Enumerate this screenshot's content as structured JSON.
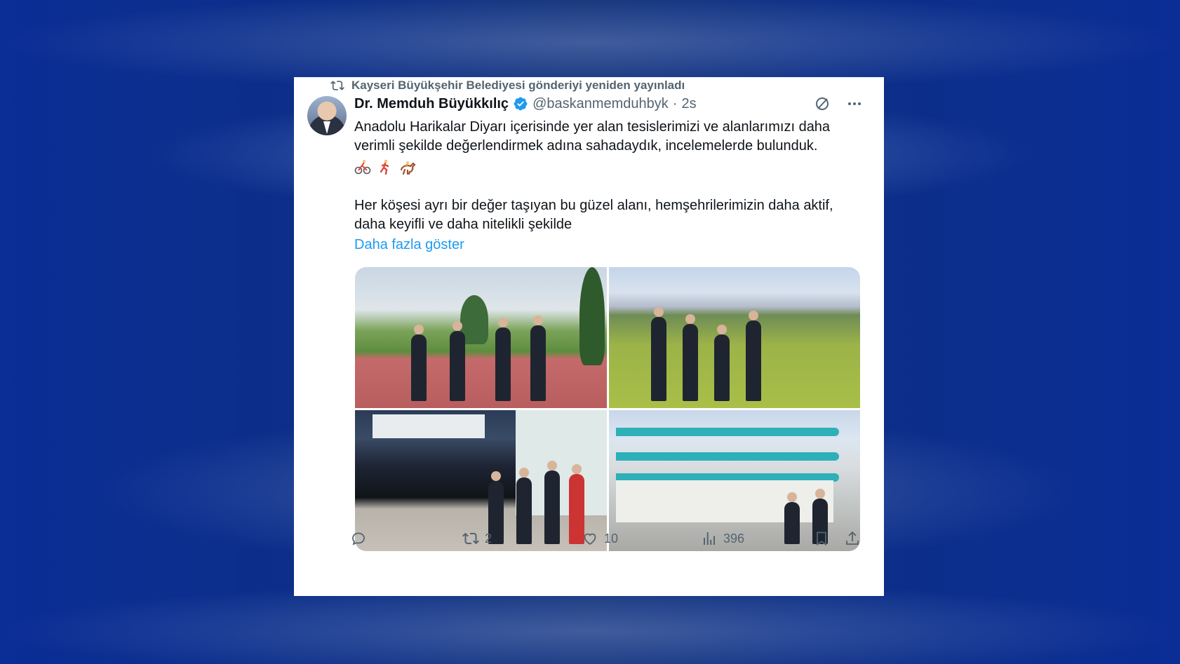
{
  "repost": {
    "text": "Kayseri Büyükşehir Belediyesi gönderiyi yeniden yayınladı"
  },
  "tweet": {
    "author_name": "Dr. Memduh Büyükkılıç",
    "handle": "@baskanmemduhbyk",
    "separator": "·",
    "time": "2s",
    "paragraph1": "Anadolu Harikalar Diyarı içerisinde yer alan tesislerimizi ve alanlarımızı daha verimli şekilde değerlendirmek adına sahadaydık, incelemelerde bulunduk.",
    "emojis": [
      "cyclist-emoji",
      "runner-emoji",
      "horse-racing-emoji"
    ],
    "paragraph2": "Her köşesi ayrı bir değer taşıyan bu güzel alanı, hemşehrilerimizin daha aktif, daha keyifli ve daha nitelikli şekilde",
    "show_more": "Daha fazla göster"
  },
  "actions": {
    "reply_count": "",
    "repost_count": "2",
    "like_count": "10",
    "views_count": "396"
  },
  "colors": {
    "accent": "#1d9bf0",
    "text": "#0f1419",
    "muted": "#536471",
    "background": "#0b2f8f"
  }
}
